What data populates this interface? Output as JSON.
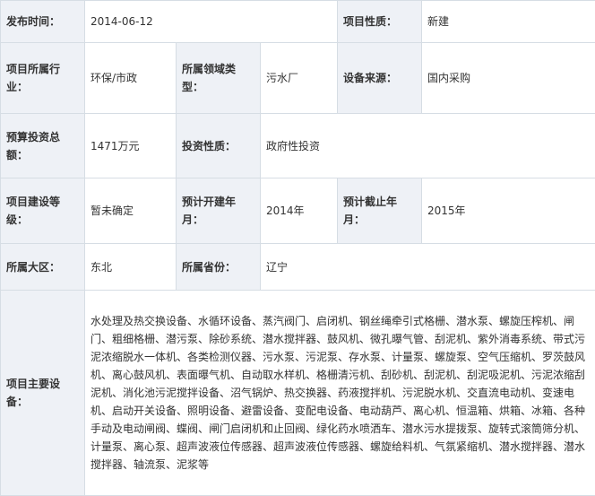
{
  "rows": {
    "publish_time": {
      "label": "发布时间：",
      "value": "2014-06-12"
    },
    "project_nature": {
      "label": "项目性质：",
      "value": "新建"
    },
    "industry": {
      "label": "项目所属行业：",
      "value": "环保/市政"
    },
    "domain_type": {
      "label": "所属领域类型：",
      "value": "污水厂"
    },
    "equipment_source": {
      "label": "设备来源：",
      "value": "国内采购"
    },
    "budget": {
      "label": "预算投资总额：",
      "value": "1471万元"
    },
    "investment_nature": {
      "label": "投资性质：",
      "value": "政府性投资"
    },
    "construction_level": {
      "label": "项目建设等级：",
      "value": "暂未确定"
    },
    "planned_start": {
      "label": "预计开建年月：",
      "value": "2014年"
    },
    "planned_end": {
      "label": "预计截止年月：",
      "value": "2015年"
    },
    "region": {
      "label": "所属大区：",
      "value": "东北"
    },
    "province": {
      "label": "所属省份：",
      "value": "辽宁"
    },
    "main_equipment": {
      "label": "项目主要设备：",
      "value": "水处理及热交换设备、水循环设备、蒸汽阀门、启闭机、钢丝绳牵引式格栅、潜水泵、螺旋压榨机、闸门、粗细格栅、潜污泵、除砂系统、潜水搅拌器、鼓风机、微孔曝气管、刮泥机、紫外消毒系统、带式污泥浓缩脱水一体机、各类检测仪器、污水泵、污泥泵、存水泵、计量泵、螺旋泵、空气压缩机、罗茨鼓风机、离心鼓风机、表面曝气机、自动取水样机、格栅清污机、刮砂机、刮泥机、刮泥吸泥机、污泥浓缩刮泥机、消化池污泥搅拌设备、沼气锅炉、热交换器、药液搅拌机、污泥脱水机、交直流电动机、变速电机、启动开关设备、照明设备、避雷设备、变配电设备、电动葫芦、离心机、恒温箱、烘箱、冰箱、各种手动及电动闸阀、蝶阀、闸门启闭机和止回阀、绿化药水喷洒车、潜水污水提拨泵、旋转式滚筒筛分机、计量泵、离心泵、超声波液位传感器、超声波液位传感器、螺旋给料机、气氛紧缩机、潜水搅拌器、潜水搅拌器、轴流泵、泥浆等"
    }
  }
}
